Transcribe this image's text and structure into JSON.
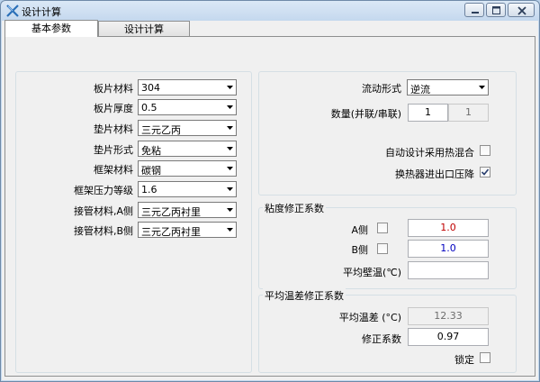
{
  "window": {
    "title": "设计计算",
    "tabs": [
      {
        "label": "基本参数",
        "active": true
      },
      {
        "label": "设计计算",
        "active": false
      }
    ]
  },
  "left_panel": {
    "rows": [
      {
        "label": "板片材料",
        "value": "304"
      },
      {
        "label": "板片厚度",
        "value": "0.5"
      },
      {
        "label": "垫片材料",
        "value": "三元乙丙"
      },
      {
        "label": "垫片形式",
        "value": "免粘"
      },
      {
        "label": "框架材料",
        "value": "碳钢"
      },
      {
        "label": "框架压力等级",
        "value": "1.6"
      },
      {
        "label": "接管材料,A侧",
        "value": "三元乙丙衬里"
      },
      {
        "label": "接管材料,B侧",
        "value": "三元乙丙衬里"
      }
    ]
  },
  "flow_panel": {
    "flow_label": "流动形式",
    "flow_value": "逆流",
    "count_label": "数量(并联/串联)",
    "parallel_value": "1",
    "series_value": "1",
    "auto_mix_label": "自动设计采用热混合",
    "auto_mix_checked": false,
    "pressure_drop_label": "换热器进出口压降",
    "pressure_drop_checked": true
  },
  "viscosity_panel": {
    "title": "粘度修正系数",
    "a_label": "A侧",
    "a_checked": false,
    "a_value": "1.0",
    "b_label": "B侧",
    "b_checked": false,
    "b_value": "1.0",
    "wall_temp_label": "平均壁温(℃)",
    "wall_temp_value": ""
  },
  "temp_diff_panel": {
    "title": "平均温差修正系数",
    "mean_temp_diff_label": "平均温差 (°C)",
    "mean_temp_diff_value": "12.33",
    "correction_label": "修正系数",
    "correction_value": "0.97",
    "lock_label": "锁定",
    "lock_checked": false
  },
  "colors": {
    "a_value_color": "#c00000",
    "b_value_color": "#0000c0"
  }
}
